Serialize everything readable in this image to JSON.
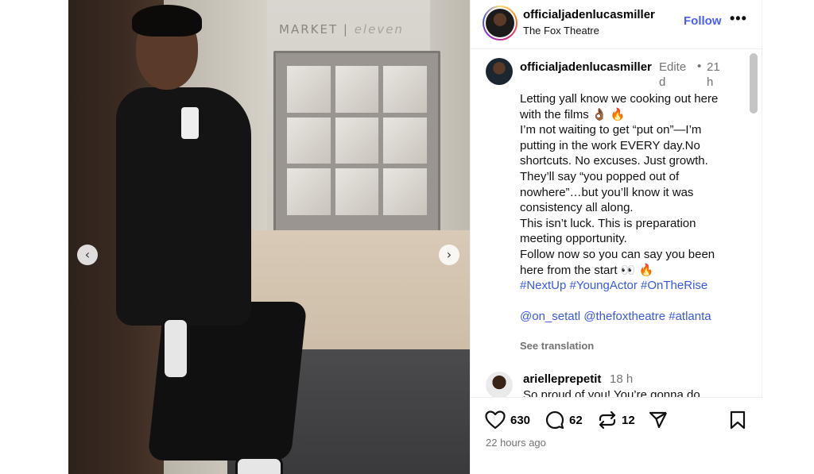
{
  "post": {
    "username": "officialjadenlucasmiller",
    "location": "The Fox Theatre",
    "follow_label": "Follow",
    "more_label": "•••"
  },
  "media": {
    "sign_text_a": "MARKET",
    "sign_text_b": "eleven",
    "prev_label": "‹",
    "next_label": "›"
  },
  "caption": {
    "username": "officialjadenlucasmiller",
    "edited_label": "Edited",
    "separator": "•",
    "time": "21h",
    "lines": [
      "Letting yall know we cooking out here with the films 👌🏾 🔥",
      "",
      "I’m not waiting to get “put on”—I’m putting in the work EVERY day.No shortcuts. No excuses. Just growth.",
      "They’ll say “you popped out of nowhere”…but you’ll know it was consistency all along.",
      "This isn’t luck. This is preparation meeting opportunity.",
      "Follow now so you can say you been here from the start 👀 🔥"
    ],
    "hashtags": "#NextUp #YoungActor #OnTheRise",
    "mentions": "@on_setatl @thefoxtheatre #atlanta",
    "see_translation": "See translation"
  },
  "reply": {
    "username": "arielleprepetit",
    "time": "18 h",
    "text": "So proud of you! You’re gonna do"
  },
  "actions": {
    "likes": "630",
    "comments": "62",
    "reposts": "12",
    "posted": "22 hours ago"
  },
  "colors": {
    "link_blue": "#4a5df9",
    "hashtag_blue": "#3a58e0",
    "muted_gray": "#737373"
  }
}
